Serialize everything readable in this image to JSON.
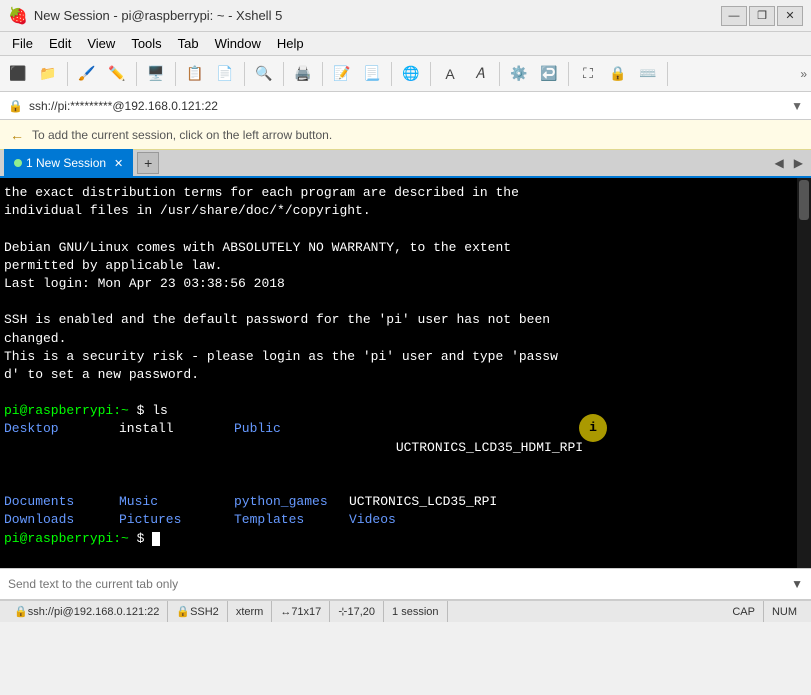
{
  "titlebar": {
    "icon": "🍓",
    "title": "New Session - pi@raspberrypi: ~ - Xshell 5",
    "minimize": "—",
    "restore": "❐",
    "close": "✕"
  },
  "menubar": {
    "items": [
      "File",
      "Edit",
      "View",
      "Tools",
      "Tab",
      "Window",
      "Help"
    ]
  },
  "addressbar": {
    "text": "ssh://pi:*********@192.168.0.121:22"
  },
  "infobar": {
    "text": "To add the current session, click on the left arrow button."
  },
  "tabbar": {
    "tab_label": "1 New Session",
    "add_label": "+"
  },
  "terminal": {
    "lines": [
      "the exact distribution terms for each program are described in the",
      "individual files in /usr/share/doc/*/copyright.",
      "",
      "Debian GNU/Linux comes with ABSOLUTELY NO WARRANTY, to the extent",
      "permitted by applicable law.",
      "Last login: Mon Apr 23 03:38:56 2018",
      "",
      "SSH is enabled and the default password for the 'pi' user has not been",
      "changed.",
      "This is a security risk - please login as the 'pi' user and type 'passw",
      "d' to set a new password."
    ],
    "prompt1": "pi@raspberrypi:~ $ ls",
    "ls_col1": [
      "Desktop",
      "Documents",
      "Downloads"
    ],
    "ls_col2": [
      "install",
      "Music",
      "Pictures"
    ],
    "ls_col3": [
      "Public",
      "python_games",
      "Templates"
    ],
    "ls_col4": [
      "UCTRONICS_LCD35_HDMI_RPI",
      "UCTRONICS_LCD35_RPI",
      "Videos"
    ],
    "prompt2": "pi@raspberrypi:~ $ "
  },
  "sendbar": {
    "placeholder": "Send text to the current tab only"
  },
  "statusbar": {
    "ssh": "ssh://pi@192.168.0.121:22",
    "protocol": "SSH2",
    "term": "xterm",
    "size": "71x17",
    "cursor": "17,20",
    "session": "1 session",
    "cap": "CAP",
    "num": "NUM"
  }
}
